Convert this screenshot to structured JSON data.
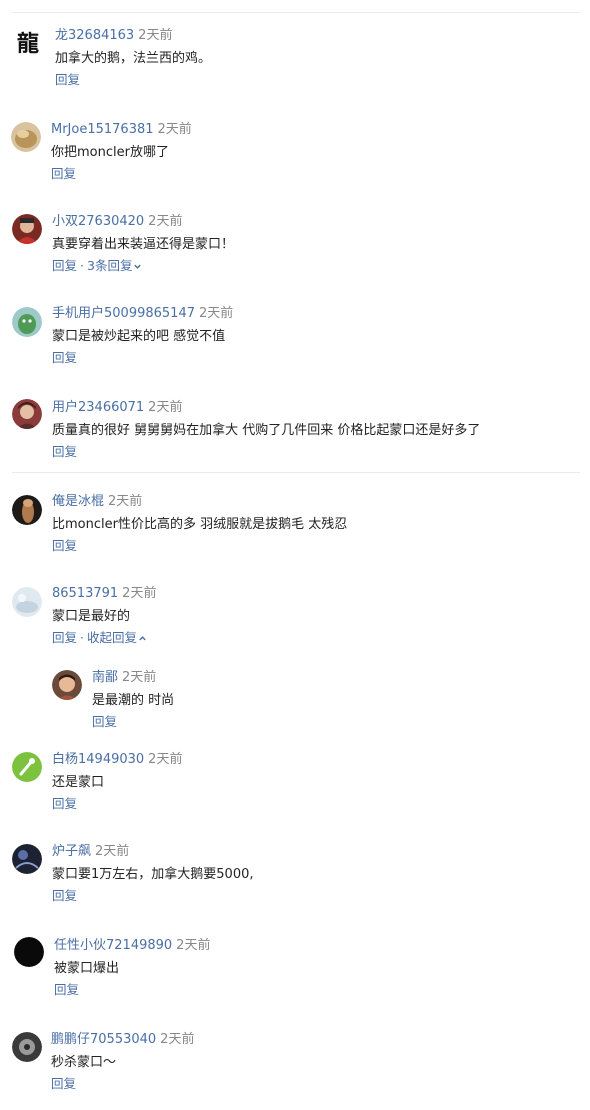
{
  "comments": [
    {
      "name": "龙32684163",
      "time": "2天前",
      "text": "加拿大的鹅，法兰西的鸡。",
      "reply": "回复",
      "avatar": "dragon-calligraphy-avatar",
      "avatar_char": "龍"
    },
    {
      "name": "MrJoe15176381",
      "time": "2天前",
      "text": "你把moncler放哪了",
      "reply": "回复",
      "avatar": "tan-blob-avatar"
    },
    {
      "name": "小双27630420",
      "time": "2天前",
      "text": "真要穿着出来装逼还得是蒙口！",
      "reply": "回复",
      "more": "3条回复",
      "avatar": "person-red-avatar"
    },
    {
      "name": "手机用户50099865147",
      "time": "2天前",
      "text": "蒙口是被炒起来的吧 感觉不值",
      "reply": "回复",
      "avatar": "green-cartoon-avatar"
    },
    {
      "name": "用户23466071",
      "time": "2天前",
      "text": "质量真的很好 舅舅舅妈在加拿大 代购了几件回来 价格比起蒙口还是好多了",
      "reply": "回复",
      "avatar": "person-avatar"
    },
    {
      "name": "俺是冰棍",
      "time": "2天前",
      "text": "比moncler性价比高的多 羽绒服就是拔鹅毛 太残忍",
      "reply": "回复",
      "avatar": "brown-dark-avatar"
    },
    {
      "name": "86513791",
      "time": "2天前",
      "text": "蒙口是最好的",
      "reply": "回复",
      "collapse": "收起回复",
      "avatar": "light-blue-avatar"
    },
    {
      "name": "白杨14949030",
      "time": "2天前",
      "text": "还是蒙口",
      "reply": "回复",
      "avatar": "green-leaf-avatar"
    },
    {
      "name": "炉子飙",
      "time": "2天前",
      "text": "蒙口要1万左右，加拿大鹅要5000,",
      "reply": "回复",
      "avatar": "dark-night-avatar"
    },
    {
      "name": "任性小伙72149890",
      "time": "2天前",
      "text": "被蒙口爆出",
      "reply": "回复",
      "avatar": "black-circle-avatar"
    },
    {
      "name": "鹏鹏仔70553040",
      "time": "2天前",
      "text": "秒杀蒙口～",
      "reply": "回复",
      "avatar": "car-wheel-avatar"
    }
  ],
  "nested_reply": {
    "name": "南鄙",
    "time": "2天前",
    "text": "是最潮的 时尚",
    "reply": "回复",
    "avatar": "face-photo-avatar"
  },
  "separator": "·"
}
